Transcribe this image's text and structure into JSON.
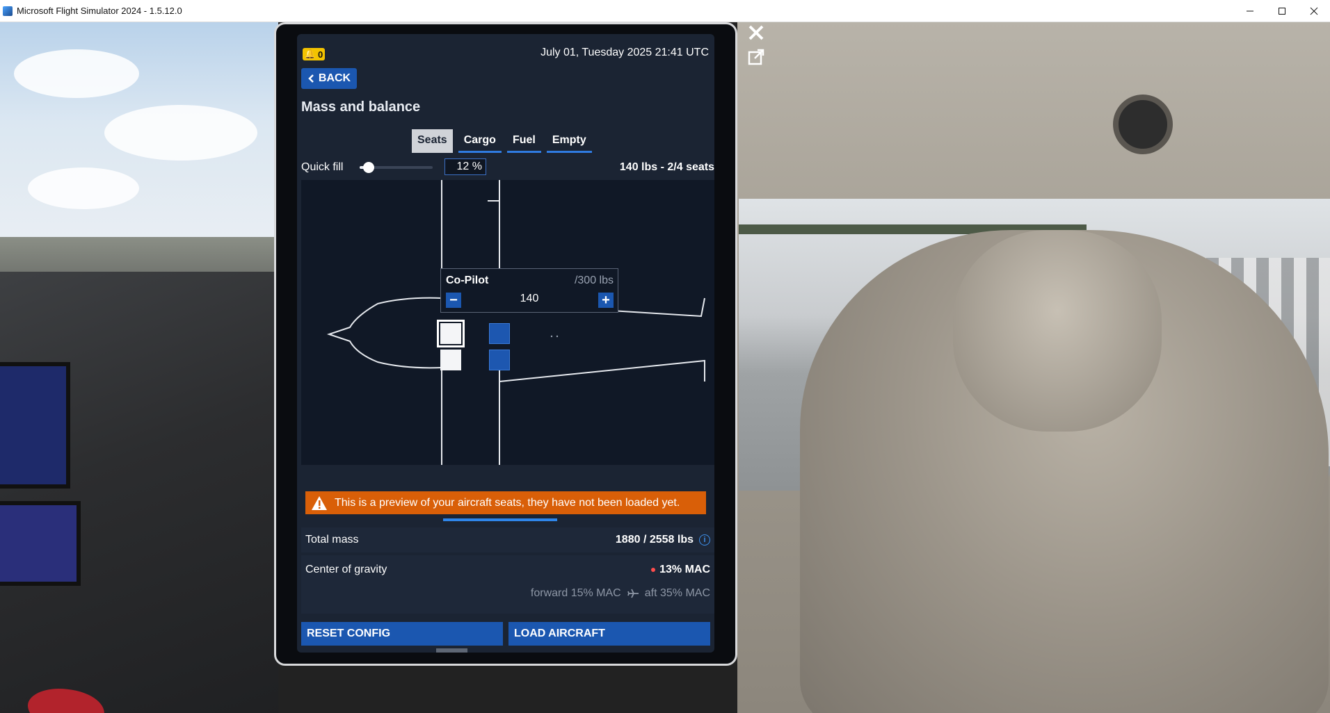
{
  "window": {
    "title": "Microsoft Flight Simulator 2024 - 1.5.12.0",
    "controls": [
      "minimize-icon",
      "maximize-icon",
      "close-icon"
    ]
  },
  "efb": {
    "notification_count": "0",
    "datetime": "July 01, Tuesday 2025 21:41 UTC",
    "back_label": "BACK",
    "page_title": "Mass and balance",
    "tabs": [
      {
        "label": "Seats",
        "active": true
      },
      {
        "label": "Cargo",
        "active": false
      },
      {
        "label": "Fuel",
        "active": false
      },
      {
        "label": "Empty",
        "active": false
      }
    ],
    "quick_fill": {
      "label": "Quick fill",
      "value_fraction": 0.12,
      "percent_text": "12 %"
    },
    "seats_summary": "140 lbs - 2/4 seats",
    "seat_tooltip": {
      "name": "Co-Pilot",
      "max": "/300 lbs",
      "value": "140",
      "minus": "−",
      "plus": "+"
    },
    "seats": [
      {
        "name": "pilot-seat",
        "state": "occupied-selected"
      },
      {
        "name": "copilot-seat",
        "state": "occupied"
      },
      {
        "name": "rear-left-seat",
        "state": "empty"
      },
      {
        "name": "rear-right-seat",
        "state": "empty"
      }
    ],
    "warning": "This is a preview of your aircraft seats, they have not been loaded yet.",
    "total_mass": {
      "label": "Total mass",
      "value": "1880 / 2558 lbs"
    },
    "center_of_gravity": {
      "label": "Center of gravity",
      "value": "13% MAC",
      "forward": "forward 15% MAC",
      "aft": "aft 35% MAC"
    },
    "buttons": {
      "reset": "RESET CONFIG",
      "load": "LOAD AIRCRAFT"
    },
    "bottom_nav": [
      {
        "icon": "pilot-icon",
        "active": false
      },
      {
        "icon": "airplane-icon",
        "active": true
      },
      {
        "icon": "info-icon",
        "active": false
      },
      {
        "icon": "gear-icon",
        "active": false
      },
      {
        "icon": "apps-grid-icon",
        "active": false
      }
    ],
    "colors": {
      "accent": "#1b57b0",
      "warning": "#d95f08",
      "notification": "#f3c300",
      "cog_dot": "#ff4d4d"
    }
  }
}
